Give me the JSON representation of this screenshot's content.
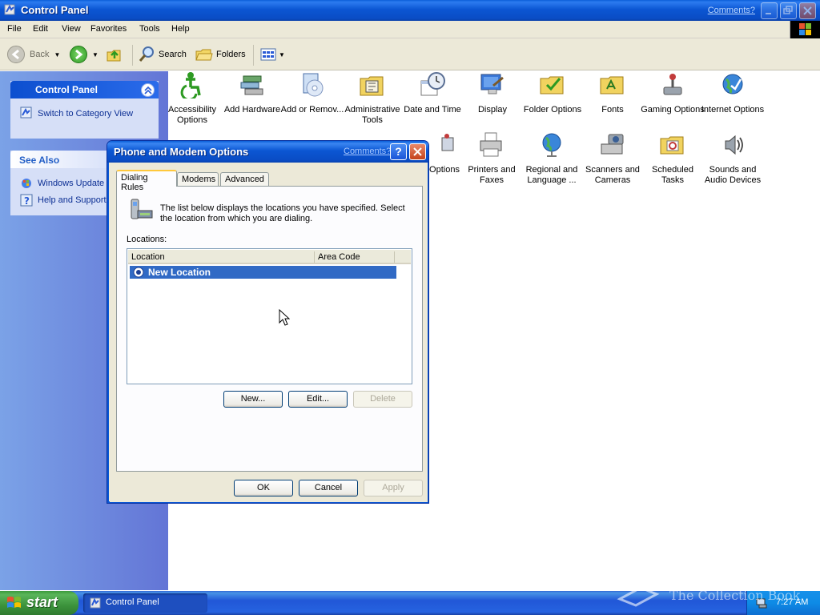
{
  "window": {
    "title": "Control Panel",
    "comments_link": "Comments?"
  },
  "menu": [
    "File",
    "Edit",
    "View",
    "Favorites",
    "Tools",
    "Help"
  ],
  "toolbar": {
    "back": "Back",
    "search": "Search",
    "folders": "Folders"
  },
  "taskpane": {
    "control_panel": {
      "title": "Control Panel",
      "switch_view": "Switch to Category View"
    },
    "see_also": {
      "title": "See Also",
      "links": [
        "Windows Update",
        "Help and Support"
      ]
    }
  },
  "items": [
    {
      "label": "Accessibility Options",
      "icon": "accessibility-icon"
    },
    {
      "label": "Add Hardware",
      "icon": "add-hardware-icon"
    },
    {
      "label": "Add or Remov...",
      "icon": "add-remove-programs-icon"
    },
    {
      "label": "Administrative Tools",
      "icon": "administrative-tools-icon"
    },
    {
      "label": "Date and Time",
      "icon": "date-time-icon"
    },
    {
      "label": "Display",
      "icon": "display-icon"
    },
    {
      "label": "Folder Options",
      "icon": "folder-options-icon"
    },
    {
      "label": "Fonts",
      "icon": "fonts-icon"
    },
    {
      "label": "Gaming Options",
      "icon": "gaming-options-icon"
    },
    {
      "label": "Internet Options",
      "icon": "internet-options-icon"
    },
    {
      "label": "Options",
      "icon": "options-icon"
    },
    {
      "label": "Printers and Faxes",
      "icon": "printers-faxes-icon"
    },
    {
      "label": "Regional and Language ...",
      "icon": "regional-language-icon"
    },
    {
      "label": "Scanners and Cameras",
      "icon": "scanners-cameras-icon"
    },
    {
      "label": "Scheduled Tasks",
      "icon": "scheduled-tasks-icon"
    },
    {
      "label": "Sounds and Audio Devices",
      "icon": "sounds-audio-icon"
    }
  ],
  "dialog": {
    "title": "Phone and Modem Options",
    "comments_link": "Comments?",
    "help_button": "?",
    "tabs": [
      "Dialing Rules",
      "Modems",
      "Advanced"
    ],
    "intro": "The list below displays the locations you have specified. Select the location from which you are dialing.",
    "locations_label": "Locations:",
    "columns": [
      "Location",
      "Area Code"
    ],
    "rows": [
      {
        "location": "New Location",
        "area_code": ""
      }
    ],
    "buttons": {
      "new": "New...",
      "edit": "Edit...",
      "delete": "Delete"
    },
    "footer": {
      "ok": "OK",
      "cancel": "Cancel",
      "apply": "Apply"
    }
  },
  "taskbar": {
    "start": "start",
    "task": "Control Panel",
    "clock": "7:27 AM",
    "watermark": "The Collection Book"
  },
  "colors": {
    "xp_blue": "#0b56d3",
    "selection": "#316ac5",
    "start_green": "#3c933c",
    "dialog_face": "#ece9d8"
  }
}
